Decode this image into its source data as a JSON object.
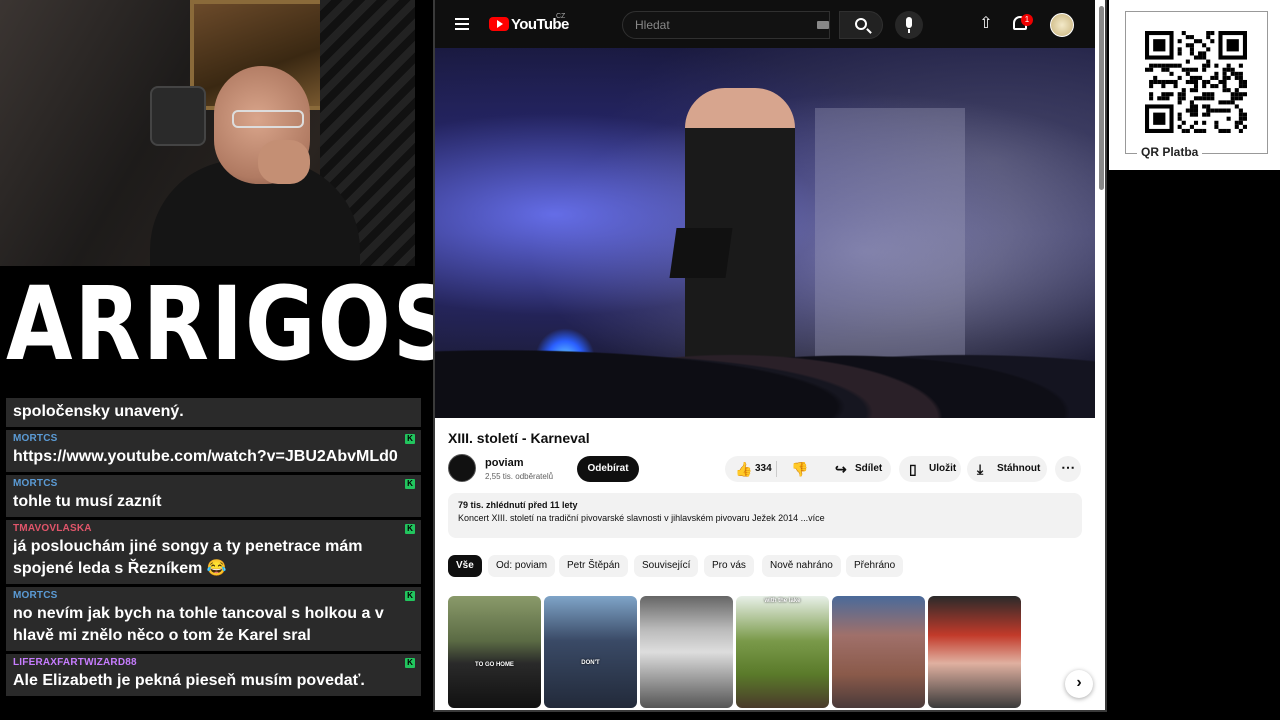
{
  "logo": {
    "text": "ARRIGOS"
  },
  "chat": {
    "messages": [
      {
        "user": "",
        "user_color": "#ffffff",
        "text": "spoločensky unavený."
      },
      {
        "user": "MORTCS",
        "user_color": "#5b9bd5",
        "text": "https://www.youtube.com/watch?v=JBU2AbvMLd0"
      },
      {
        "user": "MORTCS",
        "user_color": "#5b9bd5",
        "text": "tohle tu musí zaznít"
      },
      {
        "user": "TMAVOVLASKA",
        "user_color": "#e0556a",
        "text": "já poslouchám jiné songy a ty penetrace mám spojené leda s Řezníkem 😂"
      },
      {
        "user": "MORTCS",
        "user_color": "#5b9bd5",
        "text": "no nevím jak bych na tohle tancoval s holkou a v hlavě mi znělo něco o tom že Karel sral"
      },
      {
        "user": "LIFERAXFARTWIZARD88",
        "user_color": "#c77dff",
        "text": "Ale Elizabeth je pekná pieseň musím povedať."
      }
    ],
    "badge_color": "#22c55e"
  },
  "youtube": {
    "logo_text": "YouTube",
    "country": "CZ",
    "search_placeholder": "Hledat",
    "notification_count": "1",
    "video_title": "XIII. století - Karneval",
    "channel_name": "poviam",
    "subscribers": "2,55 tis. odběratelů",
    "subscribe_label": "Odebírat",
    "likes": "334",
    "share_label": "Sdílet",
    "save_label": "Uložit",
    "download_label": "Stáhnout",
    "description_meta": "79 tis. zhlédnutí  před 11 lety",
    "description_text": "Koncert XIII. století na tradiční pivovarské slavnosti v jihlavském pivovaru Ježek 2014 ...více",
    "chips": [
      "Vše",
      "Od: poviam",
      "Petr Štěpán",
      "Související",
      "Pro vás",
      "Nově nahráno",
      "Přehráno"
    ],
    "shorts": [
      {
        "caption": "TO GO HOME"
      },
      {
        "caption": "DON'T"
      },
      {
        "caption": ""
      },
      {
        "caption": "with the lake"
      },
      {
        "caption": ""
      },
      {
        "caption": ""
      }
    ]
  },
  "qr": {
    "label": "QR Platba"
  }
}
